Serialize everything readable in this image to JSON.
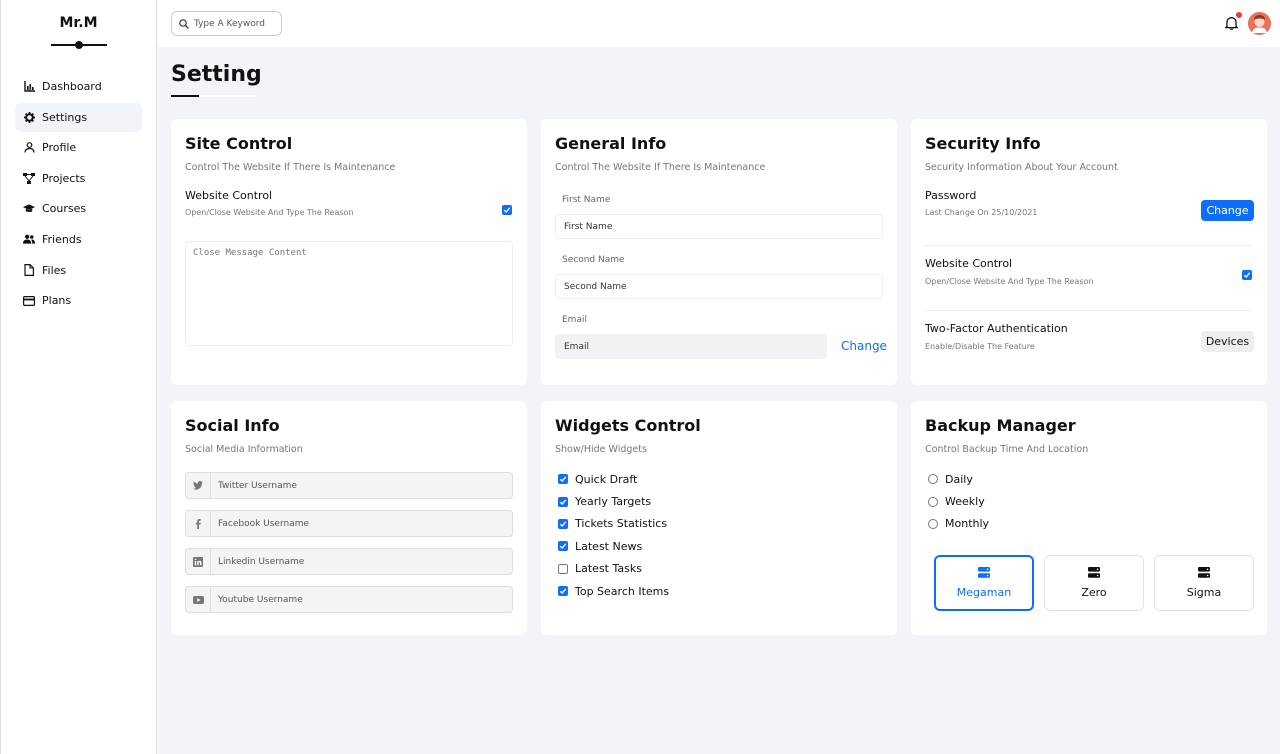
{
  "brand": "Mr.M",
  "sidebar": {
    "items": [
      {
        "label": "Dashboard",
        "icon": "chart-icon"
      },
      {
        "label": "Settings",
        "icon": "gear-icon"
      },
      {
        "label": "Profile",
        "icon": "user-icon"
      },
      {
        "label": "Projects",
        "icon": "diagram-icon"
      },
      {
        "label": "Courses",
        "icon": "graduation-cap-icon"
      },
      {
        "label": "Friends",
        "icon": "users-icon"
      },
      {
        "label": "Files",
        "icon": "file-icon"
      },
      {
        "label": "Plans",
        "icon": "credit-card-icon"
      }
    ],
    "active": "Settings"
  },
  "topbar": {
    "search_placeholder": "Type A Keyword"
  },
  "page_title": "Setting",
  "site_control": {
    "title": "Site Control",
    "subtitle": "Control The Website If There Is Maintenance",
    "row_title": "Website Control",
    "row_desc": "Open/Close Website And Type The Reason",
    "checked": true,
    "textarea_placeholder": "Close Message Content"
  },
  "general_info": {
    "title": "General Info",
    "subtitle": "Control The Website If There Is Maintenance",
    "first_label": "First Name",
    "first_placeholder": "First Name",
    "second_label": "Second Name",
    "second_placeholder": "Second Name",
    "email_label": "Email",
    "email_placeholder": "Email",
    "change_label": "Change"
  },
  "security_info": {
    "title": "Security Info",
    "subtitle": "Security Information About Your Account",
    "password_title": "Password",
    "password_desc": "Last Change On 25/10/2021",
    "change_button": "Change",
    "website_title": "Website Control",
    "website_desc": "Open/Close Website And Type The Reason",
    "website_checked": true,
    "twofa_title": "Two-Factor Authentication",
    "twofa_desc": "Enable/Disable The Feature",
    "devices_button": "Devices"
  },
  "social_info": {
    "title": "Social Info",
    "subtitle": "Social Media Information",
    "fields": [
      {
        "placeholder": "Twitter Username",
        "icon": "twitter-icon"
      },
      {
        "placeholder": "Facebook Username",
        "icon": "facebook-icon"
      },
      {
        "placeholder": "Linkedin Username",
        "icon": "linkedin-icon"
      },
      {
        "placeholder": "Youtube Username",
        "icon": "youtube-icon"
      }
    ]
  },
  "widgets_control": {
    "title": "Widgets Control",
    "subtitle": "Show/Hide Widgets",
    "items": [
      {
        "label": "Quick Draft",
        "checked": true
      },
      {
        "label": "Yearly Targets",
        "checked": true
      },
      {
        "label": "Tickets Statistics",
        "checked": true
      },
      {
        "label": "Latest News",
        "checked": true
      },
      {
        "label": "Latest Tasks",
        "checked": false
      },
      {
        "label": "Top Search Items",
        "checked": true
      }
    ]
  },
  "backup_manager": {
    "title": "Backup Manager",
    "subtitle": "Control Backup Time And Location",
    "options": [
      "Daily",
      "Weekly",
      "Monthly"
    ],
    "servers": [
      {
        "label": "Megaman",
        "active": true,
        "icon": "server-icon"
      },
      {
        "label": "Zero",
        "active": false,
        "icon": "server-icon"
      },
      {
        "label": "Sigma",
        "active": false,
        "icon": "server-icon"
      }
    ]
  },
  "colors": {
    "accent": "#0d6efd",
    "background": "#f1f4f8",
    "notification": "#e53935"
  }
}
